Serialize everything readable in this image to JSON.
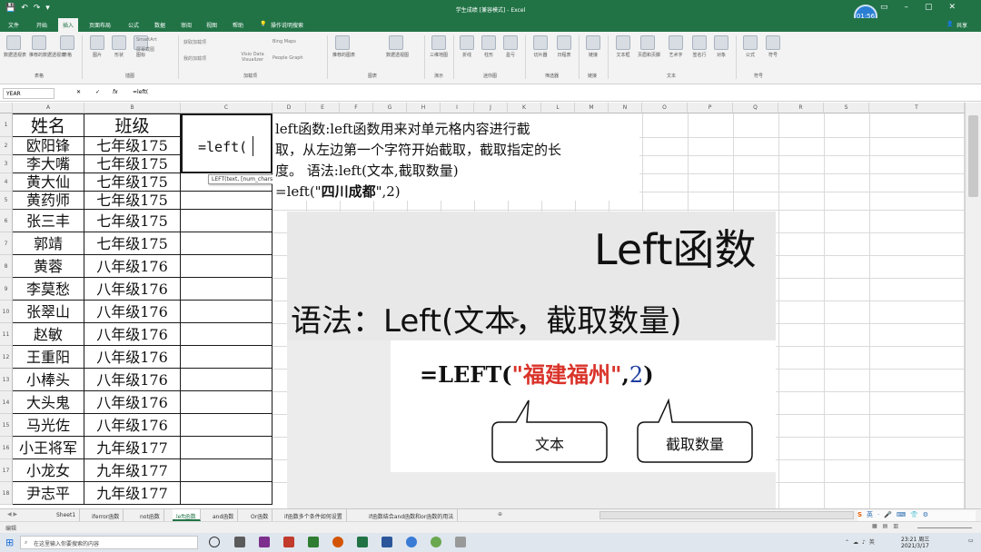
{
  "window": {
    "title": "学生成绩 [兼容模式] - Excel",
    "recorder_time": "01:56"
  },
  "menu": {
    "items": [
      "文件",
      "开始",
      "插入",
      "页面布局",
      "公式",
      "数据",
      "审阅",
      "视图",
      "帮助"
    ],
    "active": "插入",
    "tell_me": "操作说明搜索",
    "share": "共享"
  },
  "ribbon": {
    "buttons": [
      "数据透视表",
      "推荐的数据透视表",
      "表格",
      "图片",
      "形状",
      "图标",
      "3D模型",
      "获取加载项",
      "我的加载项",
      "推荐的图表",
      "数据透视图",
      "三维地图",
      "折线",
      "柱形",
      "盈亏",
      "切片器",
      "日程表",
      "链接",
      "文本框",
      "页眉和页脚",
      "艺术字",
      "签名行",
      "对象",
      "公式",
      "符号"
    ],
    "small_labels": [
      "SmartArt",
      "屏幕截图",
      "Visio Data Visualizer",
      "Bing Maps",
      "People Graph"
    ],
    "groups": [
      "表格",
      "插图",
      "加载项",
      "图表",
      "演示",
      "迷你图",
      "筛选器",
      "链接",
      "文本",
      "符号"
    ]
  },
  "formula_bar": {
    "name_box": "YEAR",
    "cancel": "✕",
    "enter": "✓",
    "fx": "fx",
    "value": "=left("
  },
  "columns": [
    "A",
    "B",
    "C",
    "D",
    "E",
    "F",
    "G",
    "H",
    "I",
    "J",
    "K",
    "L",
    "M",
    "N",
    "O",
    "P",
    "Q",
    "R",
    "S",
    "T"
  ],
  "rows": [
    "1",
    "2",
    "3",
    "4",
    "5",
    "6",
    "7",
    "8",
    "9",
    "10",
    "11",
    "12",
    "13",
    "14",
    "15",
    "16",
    "17",
    "18"
  ],
  "table": {
    "headers": [
      "姓名",
      "班级"
    ],
    "rows": [
      [
        "欧阳锋",
        "七年级175"
      ],
      [
        "李大嘴",
        "七年级175"
      ],
      [
        "黄大仙",
        "七年级175"
      ],
      [
        "黄药师",
        "七年级175"
      ],
      [
        "张三丰",
        "七年级175"
      ],
      [
        "郭靖",
        "七年级175"
      ],
      [
        "黄蓉",
        "八年级176"
      ],
      [
        "李莫愁",
        "八年级176"
      ],
      [
        "张翠山",
        "八年级176"
      ],
      [
        "赵敏",
        "八年级176"
      ],
      [
        "王重阳",
        "八年级176"
      ],
      [
        "小棒头",
        "八年级176"
      ],
      [
        "大头鬼",
        "八年级176"
      ],
      [
        "马光佐",
        "八年级176"
      ],
      [
        "小王将军",
        "九年级177"
      ],
      [
        "小龙女",
        "九年级177"
      ],
      [
        "尹志平",
        "九年级177"
      ]
    ]
  },
  "editing_cell": {
    "value": "=left(",
    "tooltip": "LEFT(text, [num_chars])"
  },
  "note": {
    "line1": "left函数:left函数用来对单元格内容进行截",
    "line2": "取，从左边第一个字符开始截取，截取指定的长",
    "line3": "度。    语法:left(文本,截取数量)",
    "example_prefix": "=left(\"",
    "example_text": "四川成都",
    "example_suffix": "\",2)"
  },
  "overlay": {
    "title": "Left函数",
    "syntax": "语法：Left(文本，截取数量)",
    "formula_prefix": "=LEFT(",
    "formula_text": "\"福建福州\"",
    "formula_comma": ",",
    "formula_num": "2",
    "formula_close": ")",
    "callout_text": "文本",
    "callout_count": "截取数量",
    "colors": {
      "text_red": "#d9332a",
      "num_blue": "#1f3fa0"
    }
  },
  "sheet_tabs": {
    "tabs": [
      "Sheet1",
      "iferror函数",
      "not函数",
      "left函数",
      "and函数",
      "Or函数",
      "if函数多个条件如何设置",
      "if函数结合and函数和or函数的用法"
    ],
    "active": "left函数",
    "add": "⊕"
  },
  "status": {
    "mode": "编辑"
  },
  "taskbar": {
    "search_placeholder": "在这里输入你要搜索的内容",
    "time": "23:21 周三",
    "date": "2021/3/17"
  }
}
